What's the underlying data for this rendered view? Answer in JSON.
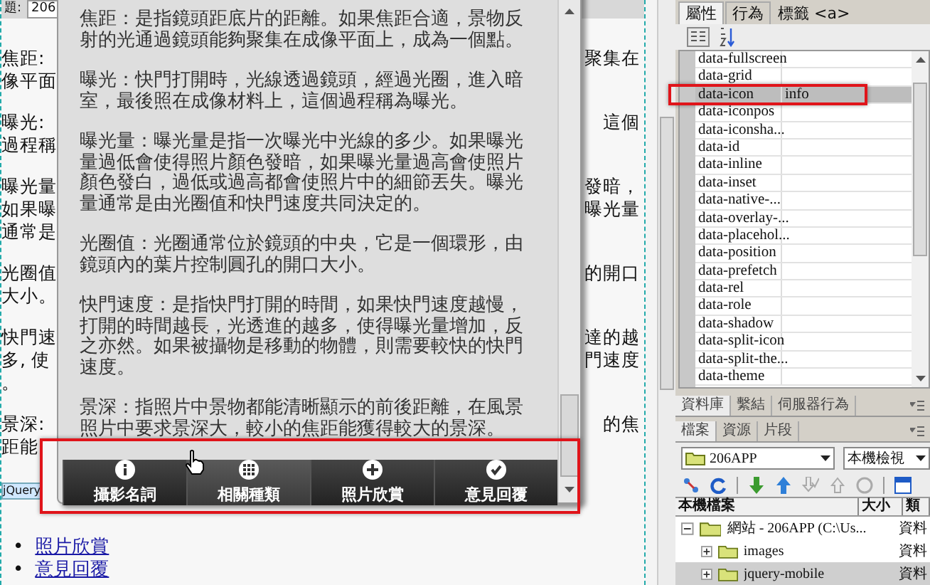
{
  "title_field": {
    "label": "題:",
    "value": "206"
  },
  "document": {
    "paragraphs": [
      {
        "left": [
          "焦距:",
          "像平面"
        ],
        "right": [
          "聚集在"
        ]
      },
      {
        "left": [
          "曝光:",
          "過程稱"
        ],
        "right": [
          "這個"
        ]
      },
      {
        "left": [
          "曝光量",
          "如果曝",
          "通常是"
        ],
        "right": [
          "發暗，",
          "曝光量"
        ]
      },
      {
        "left": [
          "光圈值",
          "大小。"
        ],
        "right": [
          "的開口"
        ]
      },
      {
        "left": [
          "快門速",
          "多, 使",
          "。"
        ],
        "right": [
          "達的越",
          "門速度"
        ]
      },
      {
        "left": [
          "景深:",
          "距能"
        ],
        "right": [
          "的焦"
        ]
      }
    ],
    "element_tag": "jQuery",
    "links": [
      {
        "marker": "•",
        "label": "照片欣賞"
      },
      {
        "marker": "•",
        "label": "意見回覆"
      }
    ]
  },
  "popup": {
    "paragraphs": [
      "焦距：是指鏡頭距底片的距離。如果焦距合適，景物反射的光通過鏡頭能夠聚集在成像平面上，成為一個點。",
      "曝光：快門打開時，光線透過鏡頭，經過光圈，進入暗室，最後照在成像材料上，這個過程稱為曝光。",
      "曝光量：曝光量是指一次曝光中光線的多少。如果曝光量過低會使得照片顏色發暗，如果曝光量過高會使照片顏色發白，過低或過高都會使照片中的細節丟失。曝光量通常是由光圈值和快門速度共同決定的。",
      "光圈值：光圈通常位於鏡頭的中央，它是一個環形，由鏡頭內的葉片控制圓孔的開口大小。",
      "快門速度：是指快門打開的時間，如果快門速度越慢，打開的時間越長，光透進的越多，使得曝光量增加，反之亦然。如果被攝物是移動的物體，則需要較快的快門速度。",
      "景深：指照片中景物都能清晰顯示的前後距離，在風景照片中要求景深大，較小的焦距能獲得較大的景深。"
    ],
    "nav": [
      {
        "label": "攝影名詞",
        "kind": "info",
        "hovered": false
      },
      {
        "label": "相關種類",
        "kind": "grid",
        "hovered": true
      },
      {
        "label": "照片欣賞",
        "kind": "plus",
        "hovered": false
      },
      {
        "label": "意見回覆",
        "kind": "check",
        "hovered": false
      }
    ]
  },
  "properties_panel": {
    "tabs": [
      {
        "label": "屬性",
        "selected": true
      },
      {
        "label": "行為",
        "selected": false
      }
    ],
    "tag_label": "標籤 <a>",
    "rows": [
      {
        "name": "data-fullscreen",
        "selected": false
      },
      {
        "name": "data-grid",
        "selected": false
      },
      {
        "name": "data-icon",
        "value": "info",
        "selected": true
      },
      {
        "name": "data-iconpos",
        "selected": false
      },
      {
        "name": "data-iconsha...",
        "selected": false
      },
      {
        "name": "data-id",
        "selected": false
      },
      {
        "name": "data-inline",
        "selected": false
      },
      {
        "name": "data-inset",
        "selected": false
      },
      {
        "name": "data-native-...",
        "selected": false
      },
      {
        "name": "data-overlay-...",
        "selected": false
      },
      {
        "name": "data-placehol...",
        "selected": false
      },
      {
        "name": "data-position",
        "selected": false
      },
      {
        "name": "data-prefetch",
        "selected": false
      },
      {
        "name": "data-rel",
        "selected": false
      },
      {
        "name": "data-role",
        "selected": false
      },
      {
        "name": "data-shadow",
        "selected": false
      },
      {
        "name": "data-split-icon",
        "selected": false
      },
      {
        "name": "data-split-the...",
        "selected": false
      },
      {
        "name": "data-theme",
        "selected": false
      }
    ]
  },
  "database_panel": {
    "tabs": [
      {
        "label": "資料庫",
        "selected": true
      },
      {
        "label": "繫結",
        "selected": false
      },
      {
        "label": "伺服器行為",
        "selected": false
      }
    ]
  },
  "files_panel": {
    "tabs": [
      {
        "label": "檔案",
        "selected": true
      },
      {
        "label": "資源",
        "selected": false
      },
      {
        "label": "片段",
        "selected": false
      }
    ],
    "site_dropdown": "206APP",
    "view_dropdown": "本機檢視",
    "columns": [
      "本機檔案",
      "大小",
      "類"
    ],
    "tree": [
      {
        "label": "網站 - 206APP (C:\\Us...",
        "type": "資料",
        "expanded": true,
        "selected": false,
        "children": [
          {
            "label": "images",
            "type": "資料",
            "expanded": false,
            "selected": false
          },
          {
            "label": "jquery-mobile",
            "type": "資料",
            "expanded": false,
            "selected": true
          }
        ]
      }
    ]
  }
}
